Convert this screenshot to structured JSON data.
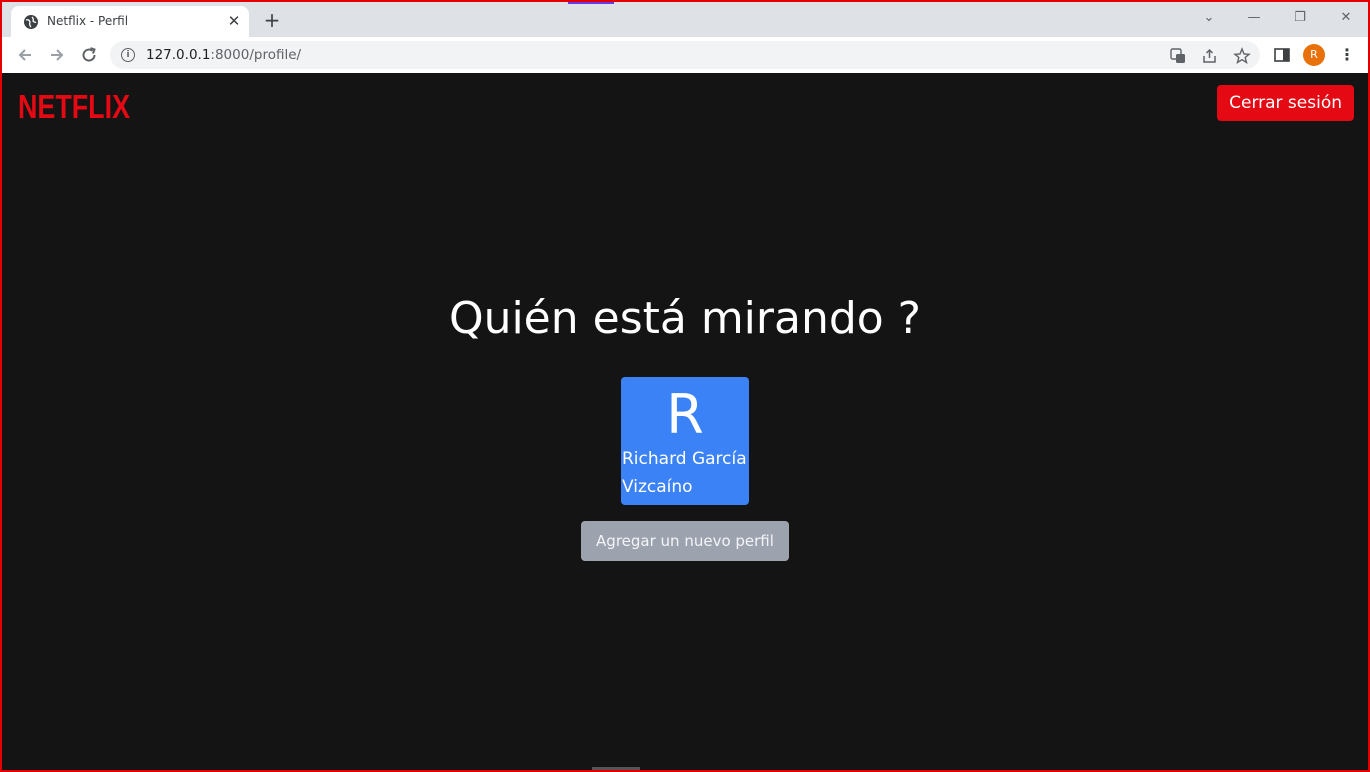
{
  "browser": {
    "tab_title": "Netflix - Perfil",
    "tab_close": "✕",
    "new_tab": "+",
    "url_host": "127.0.0.1",
    "url_path": ":8000/profile/",
    "avatar_initial": "R",
    "window_controls": [
      "⌄",
      "—",
      "❐",
      "✕"
    ]
  },
  "page": {
    "logo_text": "NETFLIX",
    "logout_label": "Cerrar sesión",
    "heading": "Quién está mirando ?",
    "profiles": [
      {
        "initial": "R",
        "name": "Richard García Vizcaíno"
      }
    ],
    "add_profile_label": "Agregar un nuevo perfil"
  },
  "colors": {
    "brand_red": "#e50914",
    "page_background": "#141414",
    "profile_tile": "#3b82f6",
    "secondary_button": "#9ca3af"
  }
}
